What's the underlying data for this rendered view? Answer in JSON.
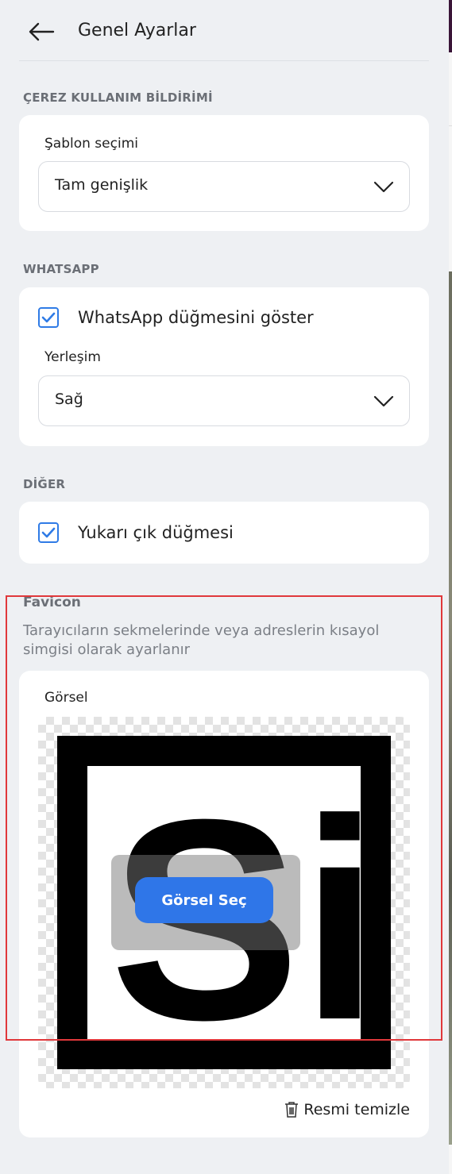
{
  "header": {
    "title": "Genel Ayarlar",
    "back_icon": "arrow-left-icon"
  },
  "cookie_section": {
    "label": "ÇEREZ KULLANIM BİLDİRİMİ",
    "template_label": "Şablon seçimi",
    "template_value": "Tam genişlik"
  },
  "whatsapp_section": {
    "label": "WHATSAPP",
    "show_button_label": "WhatsApp düğmesini göster",
    "show_button_checked": true,
    "placement_label": "Yerleşim",
    "placement_value": "Sağ"
  },
  "other_section": {
    "label": "DİĞER",
    "scroll_top_label": "Yukarı çık düğmesi",
    "scroll_top_checked": true
  },
  "favicon": {
    "title": "Favicon",
    "description": "Tarayıcıların sekmelerinde veya adreslerin kısayol simgisi olarak ayarlanır",
    "image_label": "Görsel",
    "logo_text": "Si",
    "choose_button": "Görsel Seç",
    "clear_button": "Resmi temizle"
  },
  "colors": {
    "accent": "#2f76e8",
    "highlight_frame": "#e0383b",
    "background": "#eef0f3"
  }
}
